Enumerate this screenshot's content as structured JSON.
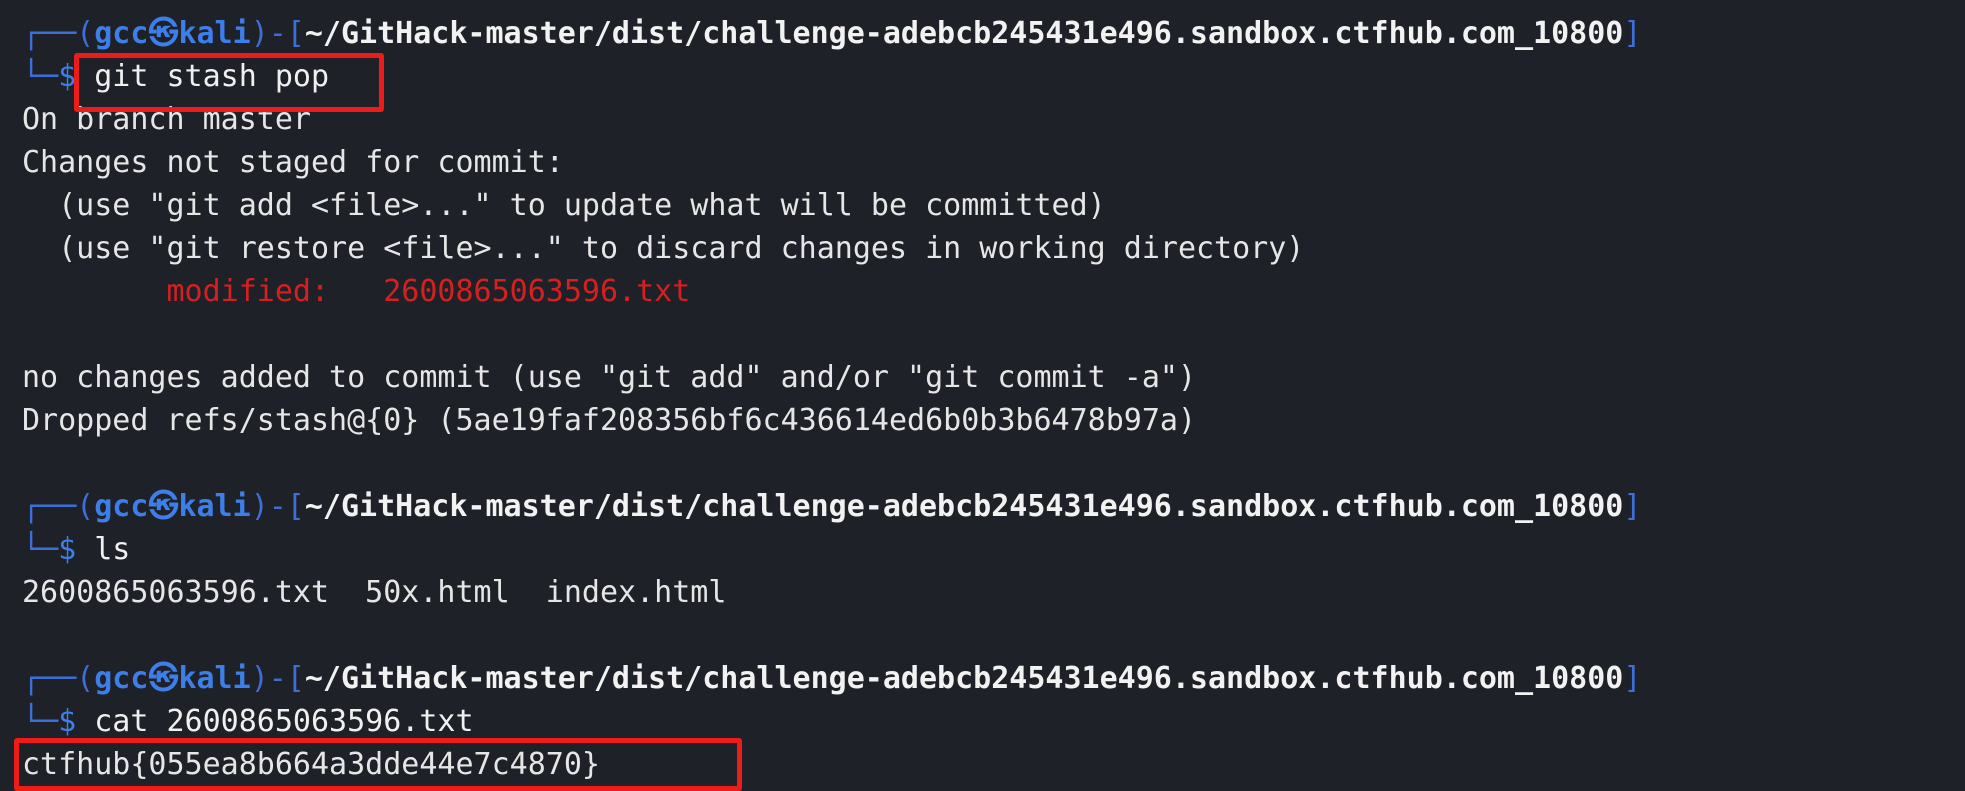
{
  "blocks": [
    {
      "prompt": {
        "top_bar": "┌──(",
        "user": "gcc",
        "at": "㉿",
        "host": "kali",
        "mid": ")-[",
        "path": "~/GitHack-master/dist/challenge-adebcb245431e496.sandbox.ctfhub.com_10800",
        "end": "]",
        "bottom_bar": "└─",
        "dollar": "$",
        "command": "git stash pop"
      },
      "output": [
        "On branch master",
        "Changes not staged for commit:",
        "  (use \"git add <file>...\" to update what will be committed)",
        "  (use \"git restore <file>...\" to discard changes in working directory)",
        "        modified:   2600865063596.txt",
        "",
        "no changes added to commit (use \"git add\" and/or \"git commit -a\")",
        "Dropped refs/stash@{0} (5ae19faf208356bf6c436614ed6b0b3b6478b97a)"
      ]
    },
    {
      "prompt": {
        "top_bar": "┌──(",
        "user": "gcc",
        "at": "㉿",
        "host": "kali",
        "mid": ")-[",
        "path": "~/GitHack-master/dist/challenge-adebcb245431e496.sandbox.ctfhub.com_10800",
        "end": "]",
        "bottom_bar": "└─",
        "dollar": "$",
        "command": "ls"
      },
      "output": [
        "2600865063596.txt  50x.html  index.html"
      ]
    },
    {
      "prompt": {
        "top_bar": "┌──(",
        "user": "gcc",
        "at": "㉿",
        "host": "kali",
        "mid": ")-[",
        "path": "~/GitHack-master/dist/challenge-adebcb245431e496.sandbox.ctfhub.com_10800",
        "end": "]",
        "bottom_bar": "└─",
        "dollar": "$",
        "command": "cat 2600865063596.txt"
      },
      "output": [
        "ctfhub{055ea8b664a3dde44e7c4870}"
      ]
    }
  ],
  "colors": {
    "background": "#1f2128",
    "prompt_blue": "#3d7ee8",
    "modified_red": "#d42020",
    "highlight_red": "#ee1b1b"
  }
}
